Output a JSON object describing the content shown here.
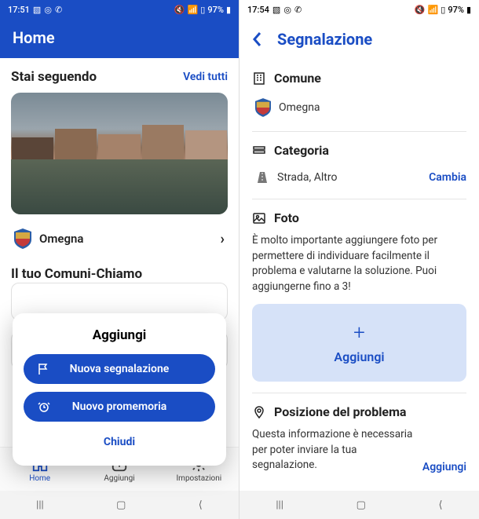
{
  "left": {
    "status": {
      "time": "17:51",
      "battery": "97%"
    },
    "header": {
      "title": "Home"
    },
    "following": {
      "title": "Stai seguendo",
      "see_all": "Vedi tutti"
    },
    "city": {
      "name": "Omegna"
    },
    "section2": {
      "title": "Il tuo Comuni-Chiamo"
    },
    "modal": {
      "title": "Aggiungi",
      "btn1": "Nuova segnalazione",
      "btn2": "Nuovo promemoria",
      "close": "Chiudi"
    },
    "nav": {
      "home": "Home",
      "add": "Aggiungi",
      "settings": "Impostazioni"
    }
  },
  "right": {
    "status": {
      "time": "17:54",
      "battery": "97%"
    },
    "header": {
      "title": "Segnalazione"
    },
    "comune": {
      "label": "Comune",
      "value": "Omegna"
    },
    "categoria": {
      "label": "Categoria",
      "value": "Strada, Altro",
      "change": "Cambia"
    },
    "foto": {
      "label": "Foto",
      "desc": "È molto importante aggiungere foto per permettere di individuare facilmente il problema e valutarne la soluzione. Puoi aggiungerne fino a 3!",
      "add": "Aggiungi"
    },
    "posizione": {
      "label": "Posizione del problema",
      "desc": "Questa informazione è necessaria per poter inviare la tua segnalazione.",
      "add": "Aggiungi"
    }
  }
}
